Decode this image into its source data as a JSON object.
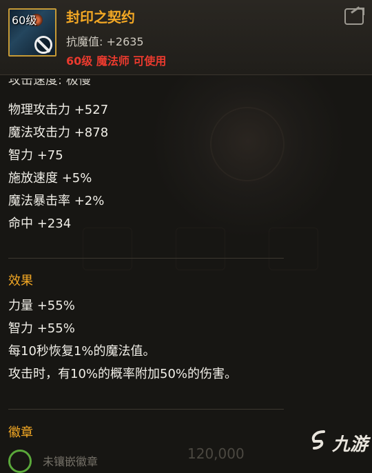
{
  "item": {
    "level_badge": "60级",
    "name": "封印之契约",
    "main_stat": "抗魔值: +2635",
    "requirement": "60级 魔法师 可使用"
  },
  "stats": {
    "cut_line": "攻击速度: 极慢",
    "lines": [
      "物理攻击力 +527",
      "魔法攻击力 +878",
      "智力 +75",
      "施放速度 +5%",
      "魔法暴击率 +2%",
      "命中 +234"
    ]
  },
  "effects": {
    "title": "效果",
    "lines": [
      "力量 +55%",
      "智力 +55%",
      "每10秒恢复1%的魔法值。",
      "攻击时，有10%的概率附加50%的伤害。"
    ]
  },
  "emblem": {
    "title": "徽章",
    "partial_text": "未镶嵌徽章",
    "partial_number": "120,000"
  },
  "watermark": {
    "text": "九游"
  },
  "colors": {
    "item_name": "#f3a824",
    "requirement": "#ea3a2e",
    "section_title": "#f3a824",
    "frame": "#c79a35"
  }
}
